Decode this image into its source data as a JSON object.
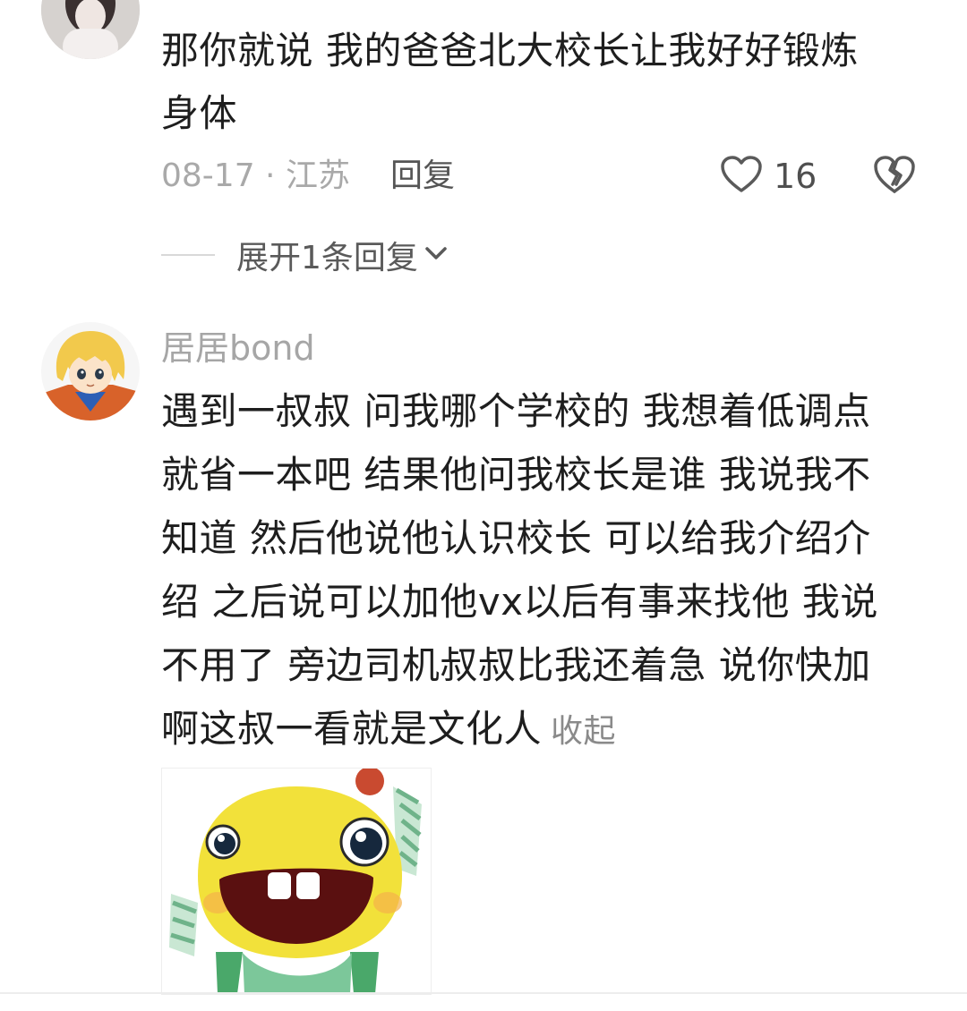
{
  "comments": [
    {
      "text_lines": [
        "那你就说 我的爸爸北大校长让我好好锻炼",
        "身体"
      ],
      "date_location": "08-17 · 江苏",
      "reply_label": "回复",
      "like_count": "16",
      "expand_replies_label": "展开1条回复"
    },
    {
      "username": "居居bond",
      "text_lines": [
        "遇到一叔叔 问我哪个学校的 我想着低调点",
        "就省一本吧 结果他问我校长是谁 我说我不",
        "知道 然后他说他认识校长 可以给我介绍介",
        "绍  之后说可以加他vx以后有事来找他 我说",
        "不用了 旁边司机叔叔比我还着急 说你快加",
        "啊这叔一看就是文化人"
      ],
      "collapse_label": "收起",
      "sticker": "yellow-smiling-creature-sticker"
    }
  ],
  "icons": {
    "like": "heart-outline-icon",
    "dislike": "broken-heart-icon",
    "expand": "chevron-down-icon"
  },
  "colors": {
    "text": "#1e1e1e",
    "meta": "#a9a9a9",
    "sticker_yellow": "#f2e13a"
  }
}
